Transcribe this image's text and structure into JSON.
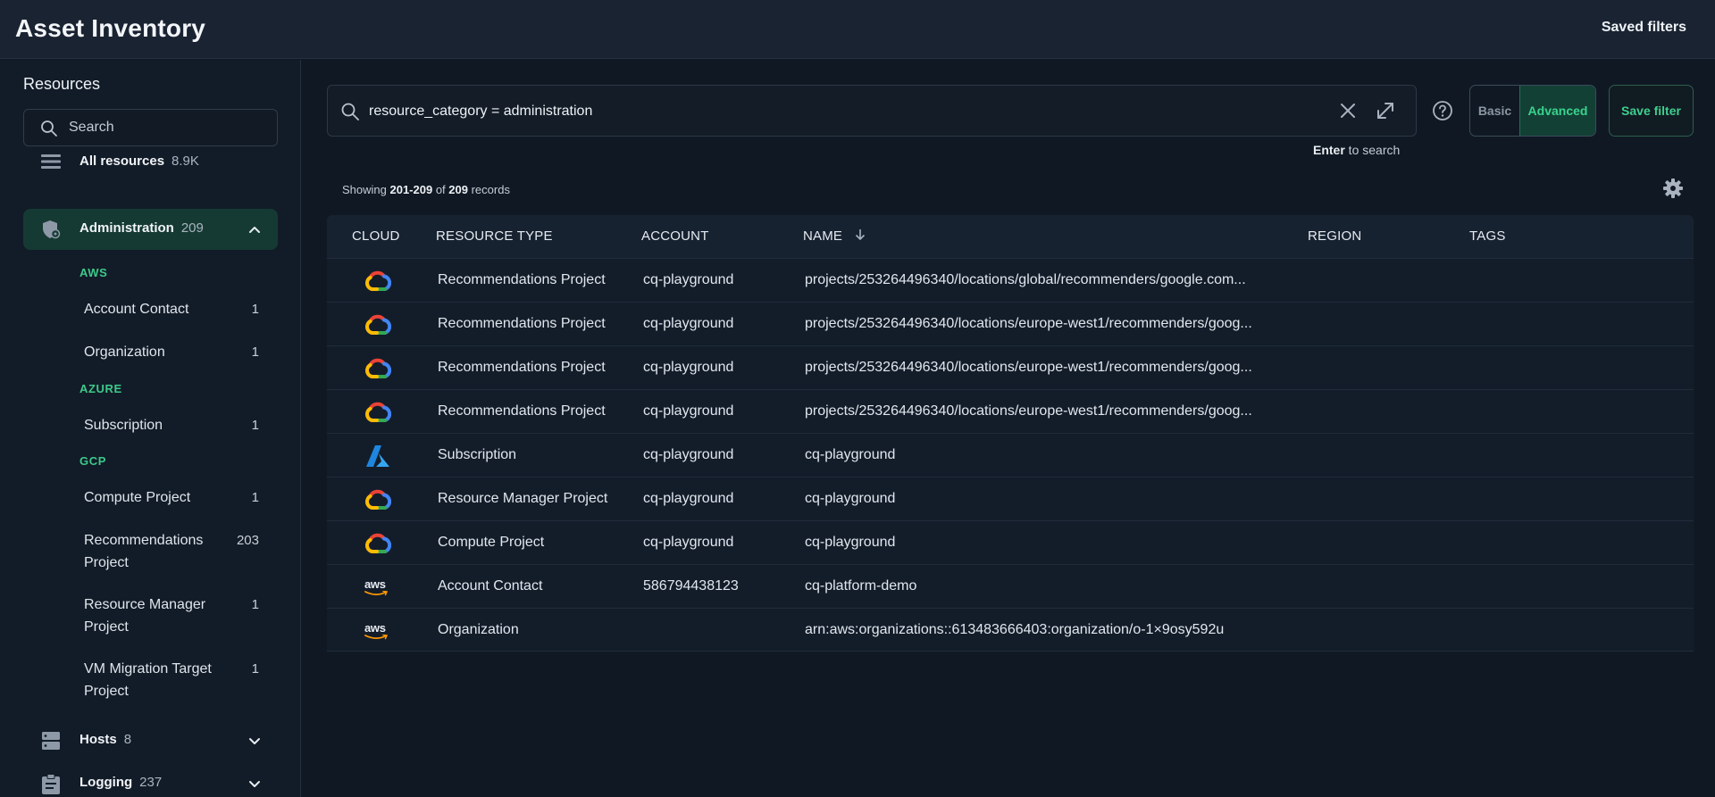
{
  "header": {
    "title": "Asset Inventory",
    "saved_filters": "Saved filters"
  },
  "sidebar": {
    "title": "Resources",
    "search_placeholder": "Search",
    "all_resources": {
      "label": "All resources",
      "count": "8.9K"
    },
    "administration": {
      "label": "Administration",
      "count": "209"
    },
    "groups": [
      {
        "name": "AWS",
        "items": [
          {
            "label": "Account Contact",
            "count": "1"
          },
          {
            "label": "Organization",
            "count": "1"
          }
        ]
      },
      {
        "name": "AZURE",
        "items": [
          {
            "label": "Subscription",
            "count": "1"
          }
        ]
      },
      {
        "name": "GCP",
        "items": [
          {
            "label": "Compute Project",
            "count": "1"
          },
          {
            "label": "Recommendations Project",
            "count": "203"
          },
          {
            "label": "Resource Manager Project",
            "count": "1"
          },
          {
            "label": "VM Migration Target Project",
            "count": "1"
          }
        ]
      }
    ],
    "hosts": {
      "label": "Hosts",
      "count": "8"
    },
    "logging": {
      "label": "Logging",
      "count": "237"
    }
  },
  "query": {
    "value": "resource_category = administration",
    "hint_key": "Enter",
    "hint_text": " to search"
  },
  "mode": {
    "basic": "Basic",
    "advanced": "Advanced",
    "save": "Save filter"
  },
  "results": {
    "prefix": "Showing ",
    "range": "201-209",
    "of": " of ",
    "total": "209",
    "suffix": " records"
  },
  "table": {
    "columns": {
      "cloud": "CLOUD",
      "type": "RESOURCE TYPE",
      "account": "ACCOUNT",
      "name": "NAME",
      "region": "REGION",
      "tags": "TAGS"
    },
    "rows": [
      {
        "cloud": "gcp",
        "type": "Recommendations Project",
        "account": "cq-playground",
        "name": "projects/253264496340/locations/global/recommenders/google.com...",
        "region": "",
        "tags": ""
      },
      {
        "cloud": "gcp",
        "type": "Recommendations Project",
        "account": "cq-playground",
        "name": "projects/253264496340/locations/europe-west1/recommenders/goog...",
        "region": "",
        "tags": ""
      },
      {
        "cloud": "gcp",
        "type": "Recommendations Project",
        "account": "cq-playground",
        "name": "projects/253264496340/locations/europe-west1/recommenders/goog...",
        "region": "",
        "tags": ""
      },
      {
        "cloud": "gcp",
        "type": "Recommendations Project",
        "account": "cq-playground",
        "name": "projects/253264496340/locations/europe-west1/recommenders/goog...",
        "region": "",
        "tags": ""
      },
      {
        "cloud": "azure",
        "type": "Subscription",
        "account": "cq-playground",
        "name": "cq-playground",
        "region": "",
        "tags": ""
      },
      {
        "cloud": "gcp",
        "type": "Resource Manager Project",
        "account": "cq-playground",
        "name": "cq-playground",
        "region": "",
        "tags": ""
      },
      {
        "cloud": "gcp",
        "type": "Compute Project",
        "account": "cq-playground",
        "name": "cq-playground",
        "region": "",
        "tags": ""
      },
      {
        "cloud": "aws",
        "type": "Account Contact",
        "account": "586794438123",
        "name": "cq-platform-demo",
        "region": "",
        "tags": ""
      },
      {
        "cloud": "aws",
        "type": "Organization",
        "account": "",
        "name": "arn:aws:organizations::613483666403:organization/o-1×9osy592u",
        "region": "",
        "tags": ""
      }
    ]
  },
  "icons": {
    "gcp": "google-cloud-icon",
    "azure": "azure-icon",
    "aws": "aws-icon",
    "aws_text": "aws"
  },
  "colors": {
    "accent_green": "#3ec98a",
    "active_bg": "#153a33",
    "background": "#0f1823"
  }
}
